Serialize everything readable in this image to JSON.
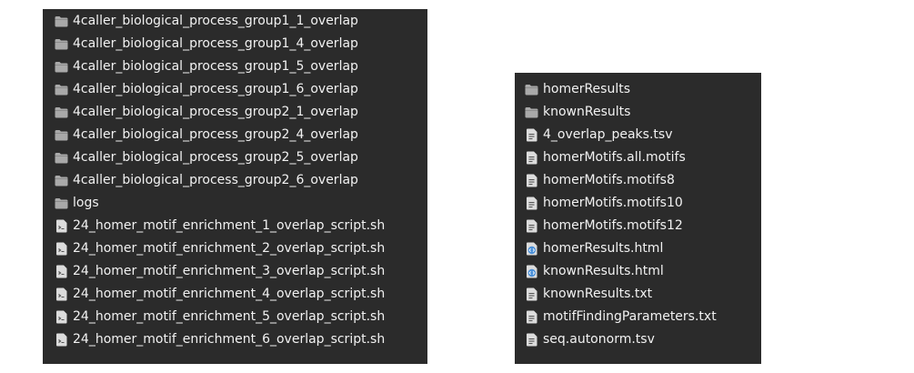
{
  "left_listing": {
    "items": [
      {
        "name": "4caller_biological_process_group1_1_overlap",
        "icon": "folder-icon"
      },
      {
        "name": "4caller_biological_process_group1_4_overlap",
        "icon": "folder-icon"
      },
      {
        "name": "4caller_biological_process_group1_5_overlap",
        "icon": "folder-icon"
      },
      {
        "name": "4caller_biological_process_group1_6_overlap",
        "icon": "folder-icon"
      },
      {
        "name": "4caller_biological_process_group2_1_overlap",
        "icon": "folder-icon"
      },
      {
        "name": "4caller_biological_process_group2_4_overlap",
        "icon": "folder-icon"
      },
      {
        "name": "4caller_biological_process_group2_5_overlap",
        "icon": "folder-icon"
      },
      {
        "name": "4caller_biological_process_group2_6_overlap",
        "icon": "folder-icon"
      },
      {
        "name": "logs",
        "icon": "folder-icon"
      },
      {
        "name": "24_homer_motif_enrichment_1_overlap_script.sh",
        "icon": "script-file-icon"
      },
      {
        "name": "24_homer_motif_enrichment_2_overlap_script.sh",
        "icon": "script-file-icon"
      },
      {
        "name": "24_homer_motif_enrichment_3_overlap_script.sh",
        "icon": "script-file-icon"
      },
      {
        "name": "24_homer_motif_enrichment_4_overlap_script.sh",
        "icon": "script-file-icon"
      },
      {
        "name": "24_homer_motif_enrichment_5_overlap_script.sh",
        "icon": "script-file-icon"
      },
      {
        "name": "24_homer_motif_enrichment_6_overlap_script.sh",
        "icon": "script-file-icon"
      }
    ]
  },
  "right_listing": {
    "items": [
      {
        "name": "homerResults",
        "icon": "folder-icon"
      },
      {
        "name": "knownResults",
        "icon": "folder-icon"
      },
      {
        "name": "4_overlap_peaks.tsv",
        "icon": "text-file-icon"
      },
      {
        "name": "homerMotifs.all.motifs",
        "icon": "text-file-icon"
      },
      {
        "name": "homerMotifs.motifs8",
        "icon": "text-file-icon"
      },
      {
        "name": "homerMotifs.motifs10",
        "icon": "text-file-icon"
      },
      {
        "name": "homerMotifs.motifs12",
        "icon": "text-file-icon"
      },
      {
        "name": "homerResults.html",
        "icon": "html-file-icon"
      },
      {
        "name": "knownResults.html",
        "icon": "html-file-icon"
      },
      {
        "name": "knownResults.txt",
        "icon": "text-file-icon"
      },
      {
        "name": "motifFindingParameters.txt",
        "icon": "text-file-icon"
      },
      {
        "name": "seq.autonorm.tsv",
        "icon": "text-file-icon"
      }
    ]
  },
  "colors": {
    "panel_background": "#2b2b2b",
    "text": "#f2f2f2",
    "folder_icon": "#a9a9a9",
    "file_icon": "#dcdcdc",
    "html_icon": "#4a90d9"
  }
}
